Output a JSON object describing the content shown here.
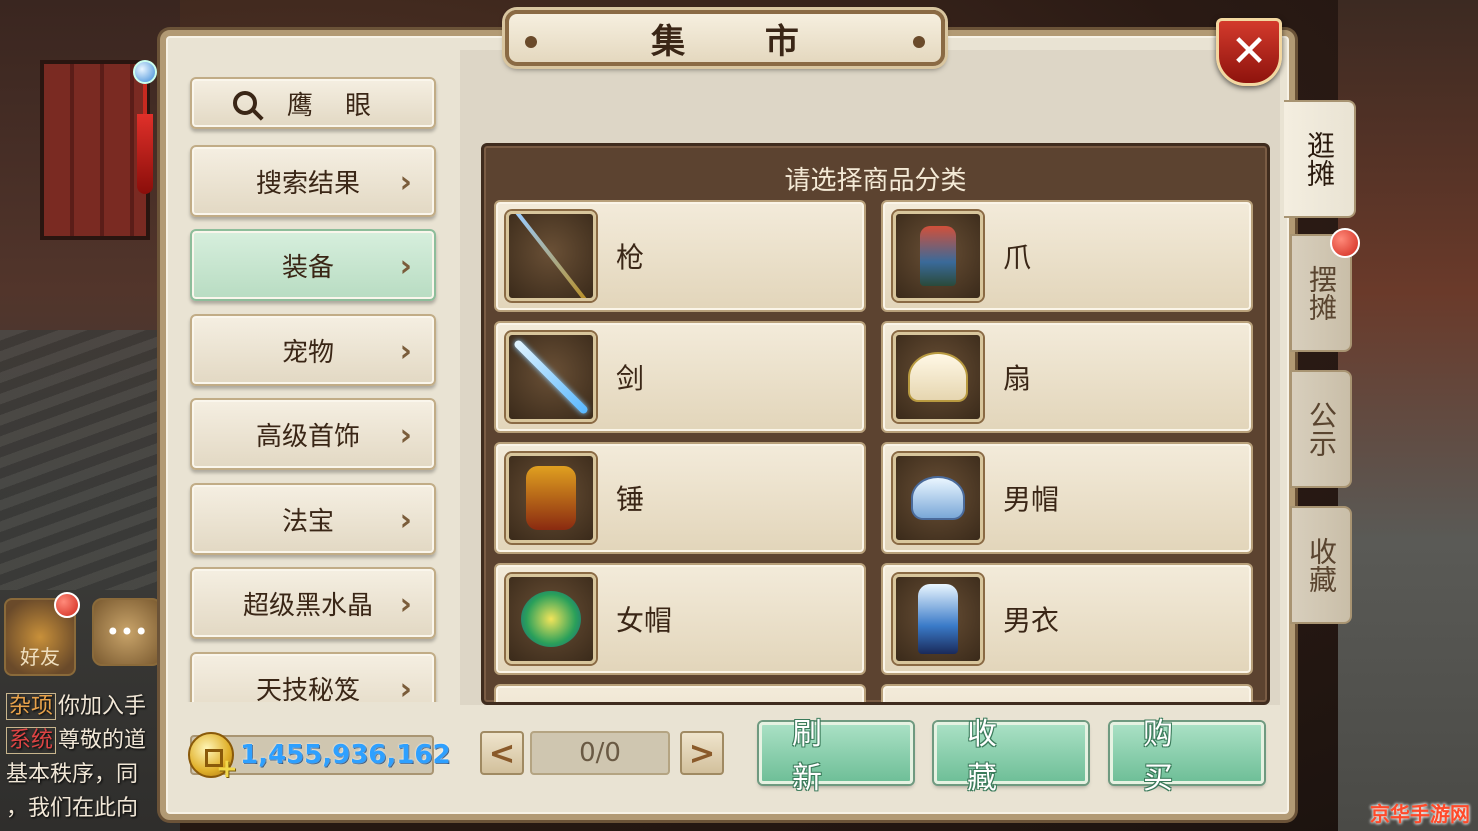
{
  "window": {
    "title": "集 市"
  },
  "left_menu": {
    "search_label": "鹰 眼",
    "items": [
      {
        "label": "搜索结果",
        "active": false
      },
      {
        "label": "装备",
        "active": true
      },
      {
        "label": "宠物",
        "active": false
      },
      {
        "label": "高级首饰",
        "active": false
      },
      {
        "label": "法宝",
        "active": false
      },
      {
        "label": "超级黑水晶",
        "active": false
      },
      {
        "label": "天技秘笈",
        "active": false
      }
    ]
  },
  "currency": {
    "amount": "1,455,936,162",
    "icon": "coin-icon"
  },
  "category_panel": {
    "title": "请选择商品分类",
    "items": [
      {
        "label": "枪",
        "icon": "spear-icon"
      },
      {
        "label": "爪",
        "icon": "claw-icon"
      },
      {
        "label": "剑",
        "icon": "sword-icon"
      },
      {
        "label": "扇",
        "icon": "fan-icon"
      },
      {
        "label": "锤",
        "icon": "hammer-icon"
      },
      {
        "label": "男帽",
        "icon": "male-hat-icon"
      },
      {
        "label": "女帽",
        "icon": "female-hat-icon"
      },
      {
        "label": "男衣",
        "icon": "male-robe-icon"
      }
    ]
  },
  "side_tabs": [
    {
      "label": "逛摊",
      "active": true
    },
    {
      "label": "摆摊",
      "active": false,
      "badge": true
    },
    {
      "label": "公示",
      "active": false
    },
    {
      "label": "收藏",
      "active": false
    }
  ],
  "pagination": {
    "text": "0/0",
    "prev": "<",
    "next": ">"
  },
  "actions": {
    "refresh": "刷新",
    "favorite": "收藏",
    "buy": "购买"
  },
  "hud": {
    "friend_label": "好友",
    "chat": [
      {
        "tag": "杂项",
        "text": "你加入手"
      },
      {
        "tag": "系统",
        "text": "尊敬的道"
      },
      {
        "tag": "",
        "text": "基本秩序，同"
      },
      {
        "tag": "",
        "text": "，我们在此向"
      }
    ]
  },
  "watermark": "京华手游网",
  "colors": {
    "accent_green": "#6fbf98",
    "close_red": "#d33a2c",
    "currency_blue": "#2ea0ff"
  }
}
